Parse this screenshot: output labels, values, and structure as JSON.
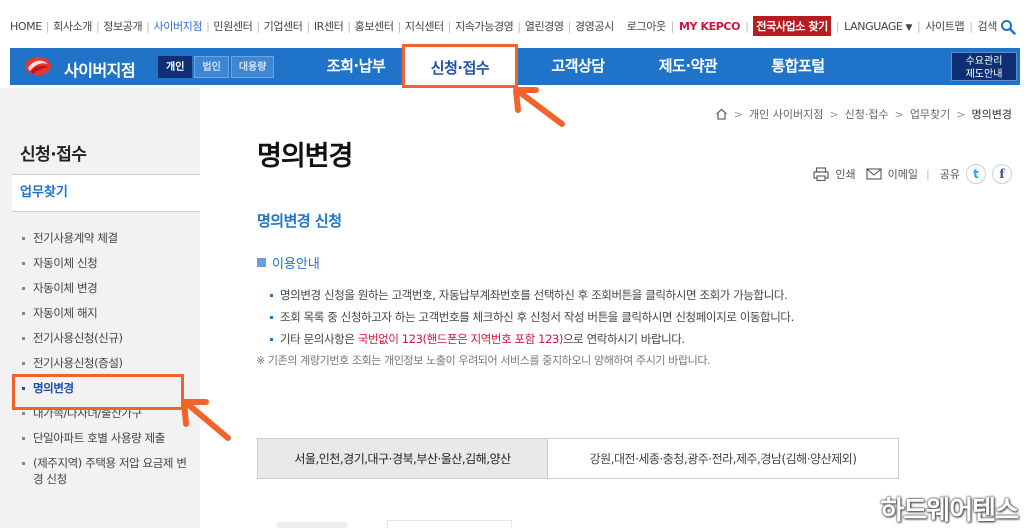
{
  "topbar": {
    "left_links": [
      "HOME",
      "회사소개",
      "정보공개",
      "사이버지점",
      "민원센터",
      "기업센터",
      "IR센터",
      "홍보센터",
      "지식센터",
      "지속가능경영",
      "열린경영",
      "경영공시"
    ],
    "active_link": "사이버지점",
    "logout": "로그아웃",
    "my_kepco": "MY KEPCO",
    "national_office": "전국사업소 찾기",
    "language": "LANGUAGE",
    "sitemap": "사이트맵",
    "search": "검색"
  },
  "gnb": {
    "brand": "사이버지점",
    "segments": [
      {
        "label": "개인",
        "active": true
      },
      {
        "label": "법인",
        "active": false
      },
      {
        "label": "대용량",
        "active": false
      }
    ],
    "menus": [
      {
        "label": "조회·납부",
        "selected": false
      },
      {
        "label": "신청·접수",
        "selected": true
      },
      {
        "label": "고객상담",
        "selected": false
      },
      {
        "label": "제도·약관",
        "selected": false
      },
      {
        "label": "통합포털",
        "selected": false
      }
    ],
    "demand_btn_line1": "수요관리",
    "demand_btn_line2": "제도안내",
    "accent_color": "#1f73c8",
    "highlight_color": "#f0642b"
  },
  "breadcrumb": {
    "items": [
      "개인 사이버지점",
      "신청·접수",
      "업무찾기",
      "명의변경"
    ]
  },
  "sidebar": {
    "title": "신청·접수",
    "subtitle": "업무찾기",
    "items": [
      {
        "label": "전기사용계약 체결",
        "active": false
      },
      {
        "label": "자동이체 신청",
        "active": false
      },
      {
        "label": "자동이체 변경",
        "active": false
      },
      {
        "label": "자동이체 해지",
        "active": false
      },
      {
        "label": "전기사용신청(신규)",
        "active": false
      },
      {
        "label": "전기사용신청(증설)",
        "active": false
      },
      {
        "label": "명의변경",
        "active": true
      },
      {
        "label": "대가족/다자녀/출산가구",
        "active": false
      },
      {
        "label": "단일아파트 호별 사용량 제출",
        "active": false
      },
      {
        "label": "(제주지역) 주택용 저압 요금제 변경 신청",
        "active": false
      }
    ]
  },
  "main": {
    "page_title": "명의변경",
    "tools": {
      "print": "인쇄",
      "email": "이메일",
      "share": "공유"
    },
    "section_title": "명의변경 신청",
    "guide_heading": "이용안내",
    "guide_items": [
      {
        "text": "명의변경 신청을 원하는 고객번호, 자동납부계좌번호를 선택하신 후 조회버튼을 클릭하시면 조회가 가능합니다."
      },
      {
        "text": "조회 목록 중 신청하고자 하는 고객번호를 체크하신 후 신청서 작성 버튼을 클릭하시면 신청페이지로 이동합니다."
      },
      {
        "prefix": "기타 문의사항은 ",
        "highlight": "국번없이 123(핸드폰은 지역번호 포함 123)",
        "suffix": "으로 연락하시기 바랍니다."
      }
    ],
    "notice": "※ 기존의 계량기번호 조회는 개인정보 노출이 우려되어 서비스를 중지하오니 양해하여 주시기 바랍니다.",
    "region_tabs": [
      {
        "label": "서울,인천,경기,대구·경북,부산·울산,김해,양산",
        "active": true
      },
      {
        "label": "강원,대전·세종·충청,광주·전라,제주,경남(김해·양산제외)",
        "active": false
      }
    ]
  },
  "watermark": "하드웨어텐스"
}
